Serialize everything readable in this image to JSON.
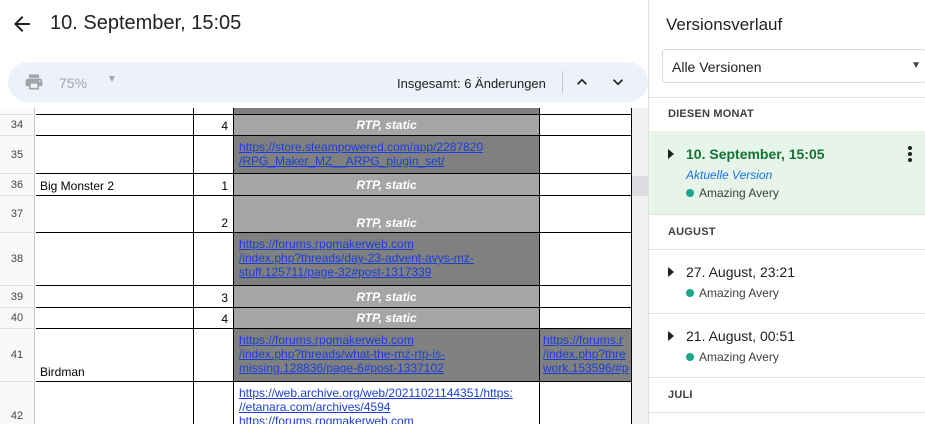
{
  "header": {
    "title": "10. September, 15:05"
  },
  "toolbar": {
    "zoom": "75%",
    "changes": "Insgesamt: 6 Änderungen"
  },
  "icons": {
    "back": "arrow-back-icon",
    "print": "print-icon",
    "prev": "chevron-up-icon",
    "next": "chevron-down-icon",
    "more": "more-vert-icon"
  },
  "sheet": {
    "rows": {
      "r34": {
        "num": "34",
        "b": "4",
        "c": "RTP, static"
      },
      "r35": {
        "num": "35",
        "c_link": "https://store.steampowered.com/app/2287820\n/RPG_Maker_MZ__ARPG_plugin_set/"
      },
      "r36": {
        "num": "36",
        "a": "Big Monster 2",
        "b": "1",
        "c": "RTP, static"
      },
      "r37": {
        "num": "37",
        "b": "2",
        "c": "RTP, static"
      },
      "r38": {
        "num": "38",
        "c_link": "https://forums.rpgmakerweb.com\n/index.php?threads/day-23-advent-avys-mz-\nstuff.125711/page-32#post-1317339"
      },
      "r39": {
        "num": "39",
        "b": "3",
        "c": "RTP, static"
      },
      "r40": {
        "num": "40",
        "b": "4",
        "c": "RTP, static"
      },
      "r41": {
        "num": "41",
        "a": "Birdman",
        "c_link": "https://forums.rpgmakerweb.com\n/index.php?threads/what-the-mz-rtp-is-\nmissing.128836/page-6#post-1337102",
        "d_link": "https://forums.r\n/index.php?thre\nwork.153596/#p"
      },
      "r42": {
        "num": "42",
        "c_link": "https://web.archive.org/web/20211021144351/https:\n//etanara.com/archives/4594\nhttps://forums.rpgmakerweb.com"
      }
    }
  },
  "history": {
    "title": "Versionsverlauf",
    "filter": "Alle Versionen",
    "sections": {
      "this_month": "DIESEN MONAT",
      "august": "AUGUST",
      "july": "JULI"
    },
    "versions": [
      {
        "title": "10. September, 15:05",
        "subtitle": "Aktuelle Version",
        "user": "Amazing Avery"
      },
      {
        "title": "27. August, 23:21",
        "user": "Amazing Avery"
      },
      {
        "title": "21. August, 00:51",
        "user": "Amazing Avery"
      }
    ]
  }
}
